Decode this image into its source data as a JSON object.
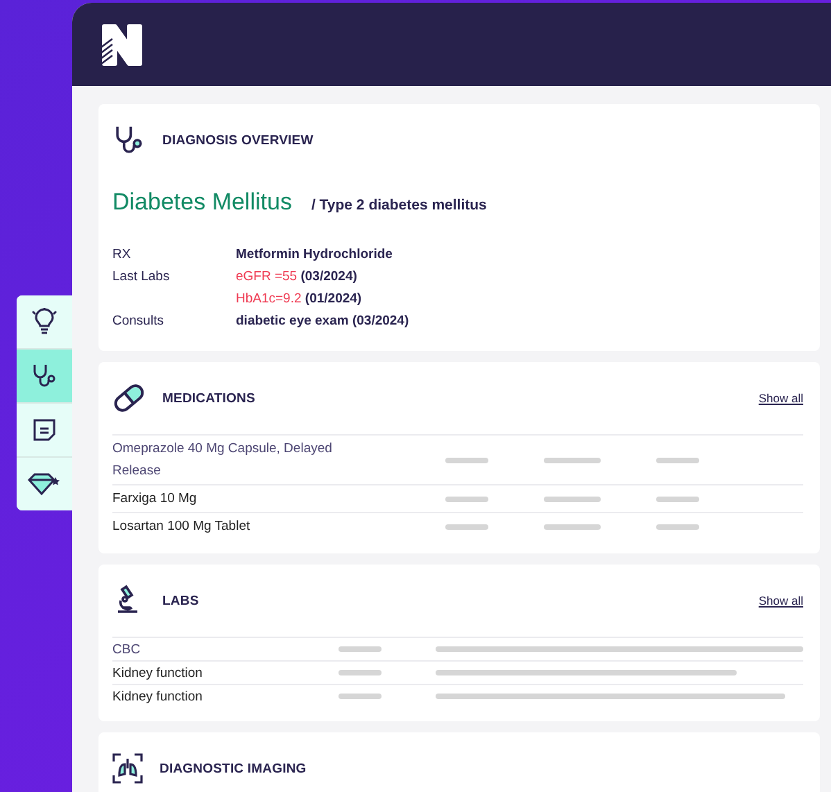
{
  "side_tabs": [
    {
      "kind": "lightbulb",
      "selected": false
    },
    {
      "kind": "stethoscope",
      "selected": true
    },
    {
      "kind": "note",
      "selected": false
    },
    {
      "kind": "diamond",
      "selected": false
    }
  ],
  "diagnosis": {
    "title": "DIAGNOSIS OVERVIEW",
    "condition": "Diabetes Mellitus",
    "subtype": "/ Type 2 diabetes mellitus",
    "details": [
      {
        "label": "RX",
        "segments": [
          {
            "text": "Metformin Hydrochloride",
            "alert": false
          }
        ]
      },
      {
        "label": "Last Labs",
        "segments": [
          {
            "text": "eGFR =55",
            "alert": true
          },
          {
            "text": "(03/2024)",
            "alert": false
          }
        ]
      },
      {
        "segments": [
          {
            "text": "HbA1c=9.2",
            "alert": true
          },
          {
            "text": "(01/2024)",
            "alert": false
          }
        ]
      },
      {
        "label": "Consults",
        "segments": [
          {
            "text": "diabetic eye exam (03/2024)",
            "alert": false
          }
        ]
      }
    ]
  },
  "medications": {
    "title": "MEDICATIONS",
    "link": "Show all",
    "rows": [
      {
        "name": "Omeprazole 40 Mg Capsule, Delayed Release",
        "muted": true
      },
      {
        "name": "Farxiga 10 Mg",
        "muted": false
      },
      {
        "name": "Losartan 100 Mg Tablet",
        "muted": false
      }
    ]
  },
  "labs": {
    "title": "LABS",
    "link": "Show all",
    "rows": [
      {
        "name": "CBC",
        "muted": true
      },
      {
        "name": "Kidney function",
        "muted": false
      },
      {
        "name": "Kidney function",
        "muted": false
      }
    ]
  },
  "imaging": {
    "title": "DIAGNOSTIC IMAGING"
  }
}
